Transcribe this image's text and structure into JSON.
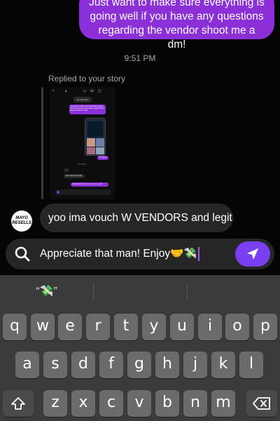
{
  "chat": {
    "outgoing_message": "Just want to make sure everything is going well if you have any questions regarding the vendor shoot me a dm!",
    "timestamp": "9:51 PM",
    "replied_label": "Replied to your story",
    "story_preview": {
      "chip": "No Vendors",
      "purple_text": "Just want to make sure everything is going well if you have any questions regarding the vendor shoot me a dm!",
      "mini_purple": "Bet good!",
      "time": "9:51 PM",
      "gray_text": "I can vouch your legit",
      "purple_text_2": "Vendors W W W yo i mo vip a my vend",
      "compose_placeholder": "Message..."
    },
    "avatar_text": "MAYO RESELLS",
    "incoming_message": "yoo ima vouch W VENDORS and legit"
  },
  "composer": {
    "text": "Appreciate that man! Enjoy🤝💸",
    "icons": {
      "left": "search-icon",
      "send": "send-icon"
    }
  },
  "keyboard": {
    "suggestions": [
      "“💸”",
      "",
      ""
    ],
    "row1": [
      "q",
      "w",
      "e",
      "r",
      "t",
      "y",
      "u",
      "i",
      "o",
      "p"
    ],
    "row2": [
      "a",
      "s",
      "d",
      "f",
      "g",
      "h",
      "j",
      "k",
      "l"
    ],
    "row3": [
      "z",
      "x",
      "c",
      "v",
      "b",
      "n",
      "m"
    ],
    "shift_icon": "shift-icon",
    "delete_icon": "backspace-icon"
  },
  "colors": {
    "accent_purple": "#8b2fd9",
    "send_purple": "#7b3ff2",
    "bubble_gray": "#262626",
    "keyboard_bg": "#3b3b3b",
    "key_bg": "#6b6b6b"
  }
}
